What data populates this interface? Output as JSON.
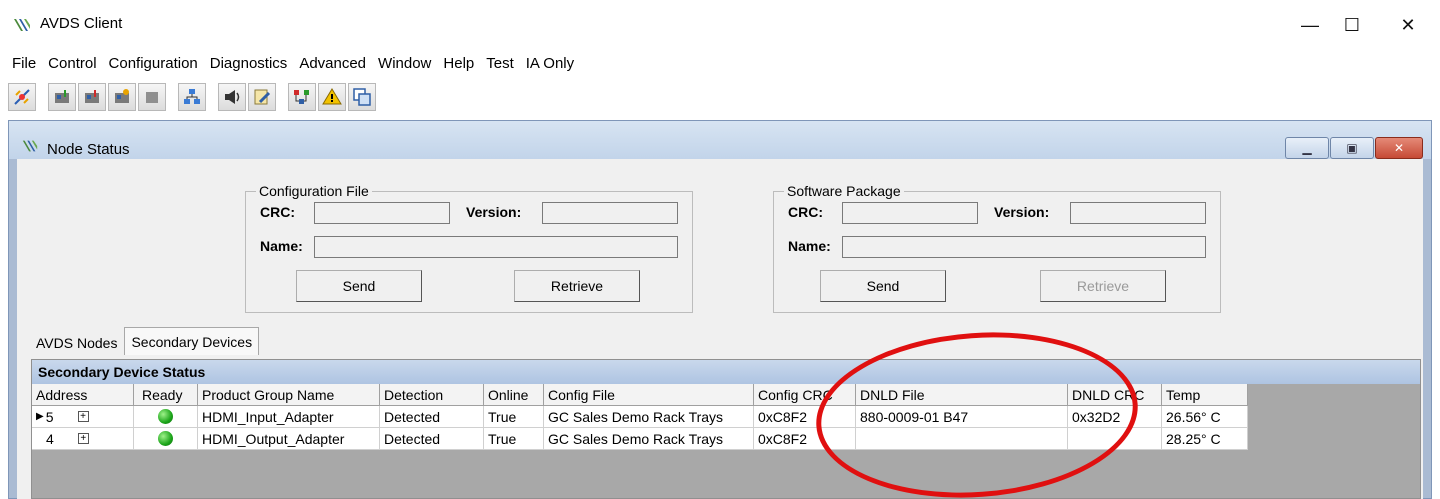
{
  "app": {
    "title": "AVDS Client",
    "icon": "avds-logo-icon"
  },
  "window_controls": {
    "minimize": "—",
    "maximize": "☐",
    "close": "✕"
  },
  "menu": [
    "File",
    "Control",
    "Configuration",
    "Diagnostics",
    "Advanced",
    "Window",
    "Help",
    "Test",
    "IA Only"
  ],
  "toolbar": {
    "icons": [
      "connect-icon",
      "node-download-icon",
      "node-upload-icon",
      "node-config-icon",
      "node-disabled-icon",
      "network-icon",
      "speaker-icon",
      "edit-document-icon",
      "device-tree-icon",
      "warning-icon",
      "window-copy-icon"
    ]
  },
  "mdi": {
    "title": "Node Status",
    "controls": {
      "minimize": "▁",
      "restore": "▣",
      "close": "✕"
    }
  },
  "config_file": {
    "legend": "Configuration File",
    "crc_label": "CRC:",
    "version_label": "Version:",
    "name_label": "Name:",
    "crc_value": "",
    "version_value": "",
    "name_value": "",
    "send": "Send",
    "retrieve": "Retrieve"
  },
  "software_package": {
    "legend": "Software Package",
    "crc_label": "CRC:",
    "version_label": "Version:",
    "name_label": "Name:",
    "crc_value": "",
    "version_value": "",
    "name_value": "",
    "send": "Send",
    "retrieve": "Retrieve",
    "retrieve_disabled": true
  },
  "tabs": [
    {
      "label": "AVDS Nodes",
      "active": false
    },
    {
      "label": "Secondary Devices",
      "active": true
    }
  ],
  "grid": {
    "caption": "Secondary Device Status",
    "columns": [
      "Address",
      "Ready",
      "Product Group Name",
      "Detection",
      "Online",
      "Config File",
      "Config CRC",
      "DNLD File",
      "DNLD CRC",
      "Temp"
    ],
    "rows": [
      {
        "selected": true,
        "address": "5",
        "ready": "green",
        "product_group": "HDMI_Input_Adapter",
        "detection": "Detected",
        "online": "True",
        "config_file": "GC Sales Demo Rack Trays",
        "config_crc": "0xC8F2",
        "dnld_file": "880-0009-01 B47",
        "dnld_crc": "0x32D2",
        "temp": "26.56° C"
      },
      {
        "selected": false,
        "address": "4",
        "ready": "green",
        "product_group": "HDMI_Output_Adapter",
        "detection": "Detected",
        "online": "True",
        "config_file": "GC Sales Demo Rack Trays",
        "config_crc": "0xC8F2",
        "dnld_file": "",
        "dnld_crc": "",
        "temp": "28.25° C"
      }
    ]
  },
  "colors": {
    "annotation": "#e01010",
    "ready_led": "#1ca51a",
    "mdi_background": "#aabbd3"
  }
}
